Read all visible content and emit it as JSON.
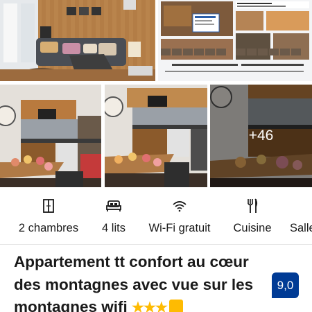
{
  "gallery": {
    "more_photos": "+46",
    "listing_screenshot": {
      "header_text": "Appartement style Industriel au cœur des montagnes avec chapelle",
      "footer_text": "Appartement près à personnes wifi et TV (Orange gratuit)"
    }
  },
  "amenities": [
    {
      "icon": "door-icon",
      "label": "2 chambres"
    },
    {
      "icon": "bed-icon",
      "label": "4 lits"
    },
    {
      "icon": "wifi-icon",
      "label": "Wi-Fi gratuit"
    },
    {
      "icon": "kitchen-icon",
      "label": "Cuisine"
    },
    {
      "icon": "bath-icon",
      "label": "Salle"
    }
  ],
  "property": {
    "title": "Appartement tt confort au cœur des montagnes avec vue sur les montagnes wifi",
    "stars": "★★★",
    "review_score": "9,0",
    "colors": {
      "score_bg": "#003b95",
      "stars": "#febb02"
    }
  }
}
